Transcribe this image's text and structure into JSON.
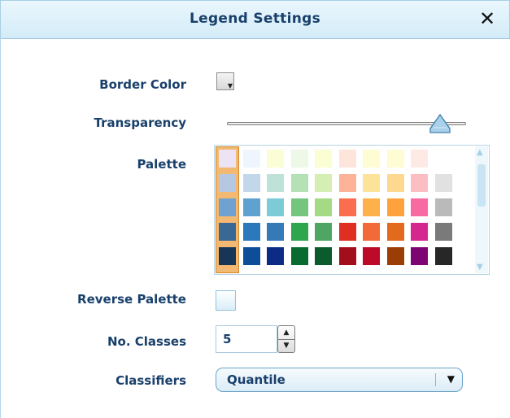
{
  "dialog": {
    "title": "Legend Settings",
    "close_glyph": "✕"
  },
  "labels": {
    "border_color": "Border Color",
    "transparency": "Transparency",
    "palette": "Palette",
    "reverse_palette": "Reverse Palette",
    "no_classes": "No. Classes",
    "classifiers": "Classifiers"
  },
  "border_color": {
    "value": "#d8d8d8"
  },
  "transparency": {
    "value_fraction": 0.89
  },
  "palette": {
    "selected_column": 0,
    "columns": [
      [
        "#ece4f4",
        "#b4c8e4",
        "#6fa1d1",
        "#3a6895",
        "#163557"
      ],
      [
        "#eef5fd",
        "#c2d7ea",
        "#5fa2d0",
        "#2b78ba",
        "#0e4d97"
      ],
      [
        "#fbfdd4",
        "#bfe2d8",
        "#7dcbd6",
        "#3579b6",
        "#0c2b84"
      ],
      [
        "#edf8e6",
        "#b4e1b6",
        "#76c57e",
        "#2fa54e",
        "#0a6b31"
      ],
      [
        "#fbfdd3",
        "#d4eeb4",
        "#a4d985",
        "#4fa562",
        "#0b5b2f"
      ],
      [
        "#fde5db",
        "#fdb397",
        "#fa6d4e",
        "#df2f23",
        "#a20e1c"
      ],
      [
        "#fefcd2",
        "#fde299",
        "#feb14a",
        "#f26a37",
        "#bd0a2b"
      ],
      [
        "#fefcd2",
        "#fdd88f",
        "#fea33b",
        "#e2691d",
        "#9a3e06"
      ],
      [
        "#feeae5",
        "#fcbec2",
        "#f96aa3",
        "#d4288f",
        "#7c0573"
      ],
      [
        "#ffffff",
        "#e1e1e1",
        "#bababa",
        "#7a7a7a",
        "#272727"
      ]
    ]
  },
  "reverse_palette": {
    "checked": false
  },
  "classes": {
    "value": "5"
  },
  "classifiers": {
    "selected": "Quantile"
  },
  "icons": {
    "close": "close-icon",
    "dropdown": "chevron-down-icon",
    "stepper_up": "triangle-up-icon",
    "stepper_down": "triangle-down-icon"
  },
  "colors": {
    "title_text": "#19406b",
    "titlebar_bg": "#dbeff9",
    "selection_highlight": "#f3b872",
    "accent_border": "#6aa3c7"
  }
}
